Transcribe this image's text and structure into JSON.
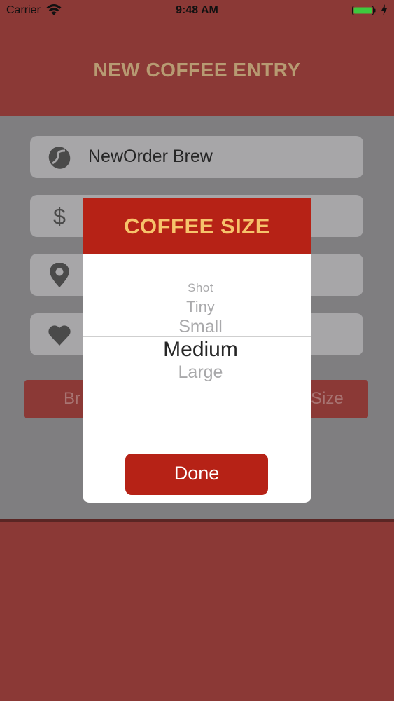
{
  "status_bar": {
    "carrier": "Carrier",
    "time": "9:48 AM"
  },
  "header": {
    "title": "NEW COFFEE ENTRY"
  },
  "form": {
    "fields": [
      {
        "icon": "coffee-bean-icon",
        "value": "NewOrder Brew"
      },
      {
        "icon": "dollar-icon",
        "value": ""
      },
      {
        "icon": "location-pin-icon",
        "value": ""
      },
      {
        "icon": "heart-icon",
        "value": ""
      }
    ],
    "save_button": {
      "left_text": "Br",
      "right_text": "Size"
    }
  },
  "modal": {
    "title": "COFFEE SIZE",
    "options": [
      "Shot",
      "Tiny",
      "Small",
      "Medium",
      "Large"
    ],
    "selected": "Medium",
    "done_label": "Done"
  },
  "colors": {
    "header_bg": "#8b3936",
    "modal_header_bg": "#b62216",
    "modal_title": "#f6c36b",
    "done_button": "#b62216",
    "overlay_gray": "#7f7e80"
  }
}
